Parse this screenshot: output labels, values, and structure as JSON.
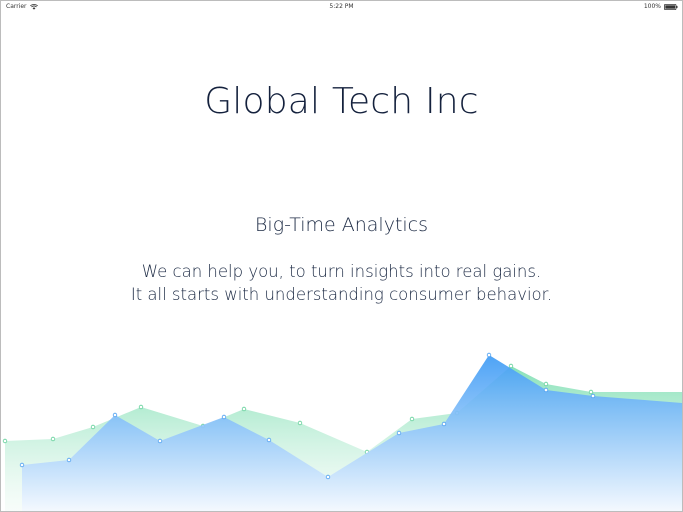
{
  "status_bar": {
    "carrier": "Carrier",
    "time": "5:22 PM",
    "battery": "100%",
    "icons": [
      "wifi-icon",
      "battery-icon"
    ]
  },
  "hero": {
    "title": "Global Tech Inc",
    "subtitle": "Big-Time Analytics",
    "tagline_line1": "We can help you, to turn insights into real gains.",
    "tagline_line2": "It all starts with understanding consumer behavior."
  },
  "chart_data": {
    "type": "area",
    "series": [
      {
        "values": [
          110,
          108,
          96,
          76,
          95,
          78,
          92,
          121,
          88,
          82,
          35,
          53,
          61
        ],
        "color": "#6ed6a4"
      },
      {
        "values": [
          134,
          129,
          84,
          110,
          86,
          109,
          146,
          102,
          93,
          24,
          59,
          65
        ],
        "color": "#4fa6f6"
      }
    ],
    "colors": {
      "green_top": "#73dcac",
      "green_bottom": "#e9f8f0",
      "blue_top": "#3e9bf5",
      "blue_bottom": "#f3f8ff"
    }
  }
}
